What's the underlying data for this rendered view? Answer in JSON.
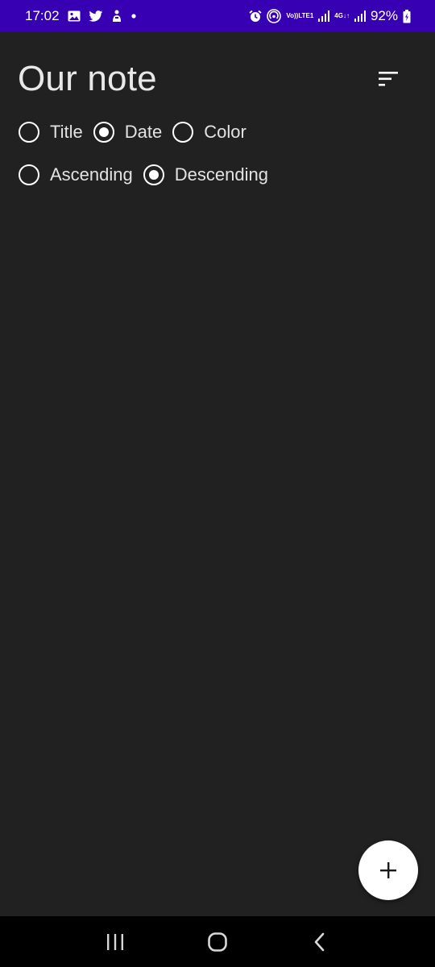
{
  "status_bar": {
    "time": "17:02",
    "battery": "92%",
    "volte_top": "Vo))",
    "volte_bottom": "LTE1",
    "network_top": "4G",
    "icons": [
      "gallery-icon",
      "twitter-icon",
      "notification-icon",
      "dot-icon",
      "alarm-icon",
      "hotspot-icon",
      "signal-icon",
      "battery-icon"
    ],
    "background_color": "#3700b3"
  },
  "header": {
    "title": "Our note",
    "sort_icon": "sort-icon"
  },
  "sort_by": {
    "options": [
      {
        "label": "Title",
        "checked": false
      },
      {
        "label": "Date",
        "checked": true
      },
      {
        "label": "Color",
        "checked": false
      }
    ]
  },
  "order": {
    "options": [
      {
        "label": "Ascending",
        "checked": false
      },
      {
        "label": "Descending",
        "checked": true
      }
    ]
  },
  "fab": {
    "icon": "plus-icon",
    "background_color": "#ffffff"
  },
  "nav_bar": {
    "items": [
      "recent-apps-icon",
      "home-icon",
      "back-icon"
    ]
  },
  "colors": {
    "background": "#212121",
    "text": "#e6e6e6",
    "accent": "#ffffff"
  }
}
